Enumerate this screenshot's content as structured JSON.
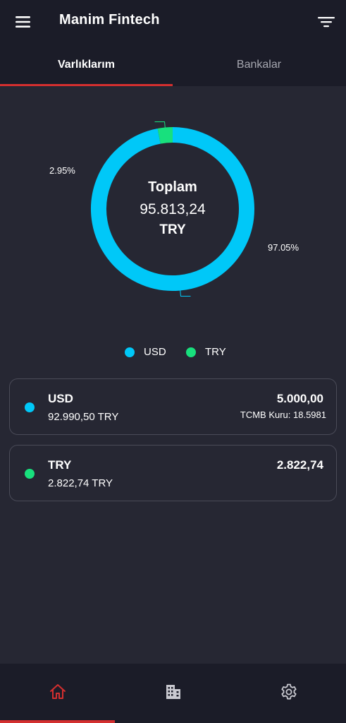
{
  "header": {
    "title": "Manim Fintech",
    "menu_icon": "hamburger-menu-icon",
    "filter_icon": "filter-lines-icon"
  },
  "tabs": [
    {
      "label": "Varlıklarım",
      "active": true
    },
    {
      "label": "Bankalar",
      "active": false
    }
  ],
  "summary": {
    "label": "Toplam",
    "amount": "95.813,24",
    "currency": "TRY"
  },
  "chart_data": {
    "type": "pie",
    "categories": [
      "USD",
      "TRY"
    ],
    "values": [
      97.05,
      2.95
    ],
    "value_labels": [
      "97.05%",
      "2.95%"
    ],
    "colors": [
      "#00c8f8",
      "#18e07d"
    ],
    "title": "",
    "legend": "bottom"
  },
  "legend": [
    {
      "label": "USD",
      "color": "#00c8f8"
    },
    {
      "label": "TRY",
      "color": "#18e07d"
    }
  ],
  "assets": [
    {
      "currency": "USD",
      "try_value": "92.990,50 TRY",
      "amount": "5.000,00",
      "rate": "TCMB Kuru: 18.5981",
      "color": "#00c8f8"
    },
    {
      "currency": "TRY",
      "try_value": "2.822,74 TRY",
      "amount": "2.822,74",
      "color": "#18e07d"
    }
  ],
  "bottom_nav": [
    {
      "icon": "home-icon",
      "active": true
    },
    {
      "icon": "buildings-icon",
      "active": false
    },
    {
      "icon": "gear-icon",
      "active": false
    }
  ],
  "colors": {
    "accent": "#d32f2f",
    "background": "#262733",
    "bar": "#1b1c28"
  }
}
